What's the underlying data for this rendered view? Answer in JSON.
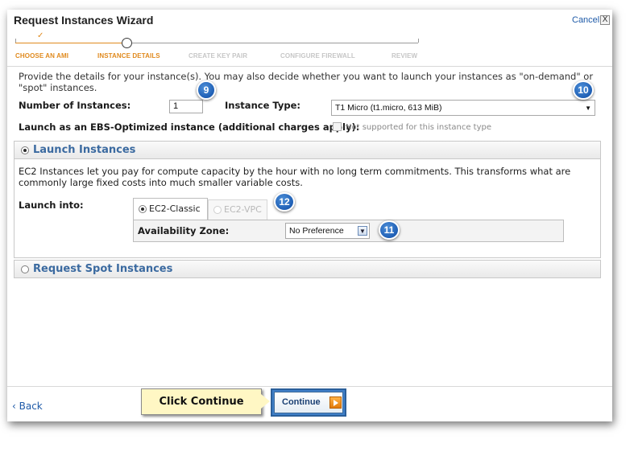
{
  "wizard": {
    "title": "Request Instances Wizard",
    "cancel_label": "Cancel",
    "close_glyph": "X",
    "check_glyph": "✓",
    "steps": [
      {
        "label": "CHOOSE AN AMI",
        "state": "done"
      },
      {
        "label": "INSTANCE DETAILS",
        "state": "current"
      },
      {
        "label": "CREATE KEY PAIR",
        "state": "pending"
      },
      {
        "label": "CONFIGURE FIREWALL",
        "state": "pending"
      },
      {
        "label": "REVIEW",
        "state": "pending"
      }
    ]
  },
  "details": {
    "intro": "Provide the details for your instance(s). You may also decide whether you want to launch your instances as \"on-demand\" or \"spot\" instances.",
    "num_instances_label": "Number of Instances:",
    "num_instances_value": "1",
    "instance_type_label": "Instance Type:",
    "instance_type_value": "T1 Micro (t1.micro, 613 MiB)",
    "ebs_label": "Launch as an EBS-Optimized instance (additional charges apply):",
    "ebs_note": "Not supported for this instance type"
  },
  "launch_panel": {
    "title": "Launch Instances",
    "description": "EC2 Instances let you pay for compute capacity by the hour with no long term commitments. This transforms what are commonly large fixed costs into much smaller variable costs.",
    "launch_into_label": "Launch into:",
    "tab_classic": "EC2-Classic",
    "tab_vpc": "EC2-VPC",
    "az_label": "Availability Zone:",
    "az_value": "No Preference"
  },
  "spot_panel": {
    "title": "Request Spot Instances"
  },
  "footer": {
    "back_label": "‹ Back",
    "callout": "Click Continue",
    "continue_label": "Continue"
  },
  "badges": {
    "b9": "9",
    "b10": "10",
    "b11": "11",
    "b12": "12",
    "color": "#1f5fb5"
  },
  "colors": {
    "accent_orange": "#e08a1e",
    "link_blue": "#1e5aa8",
    "panel_title_blue": "#3b6aa0"
  }
}
